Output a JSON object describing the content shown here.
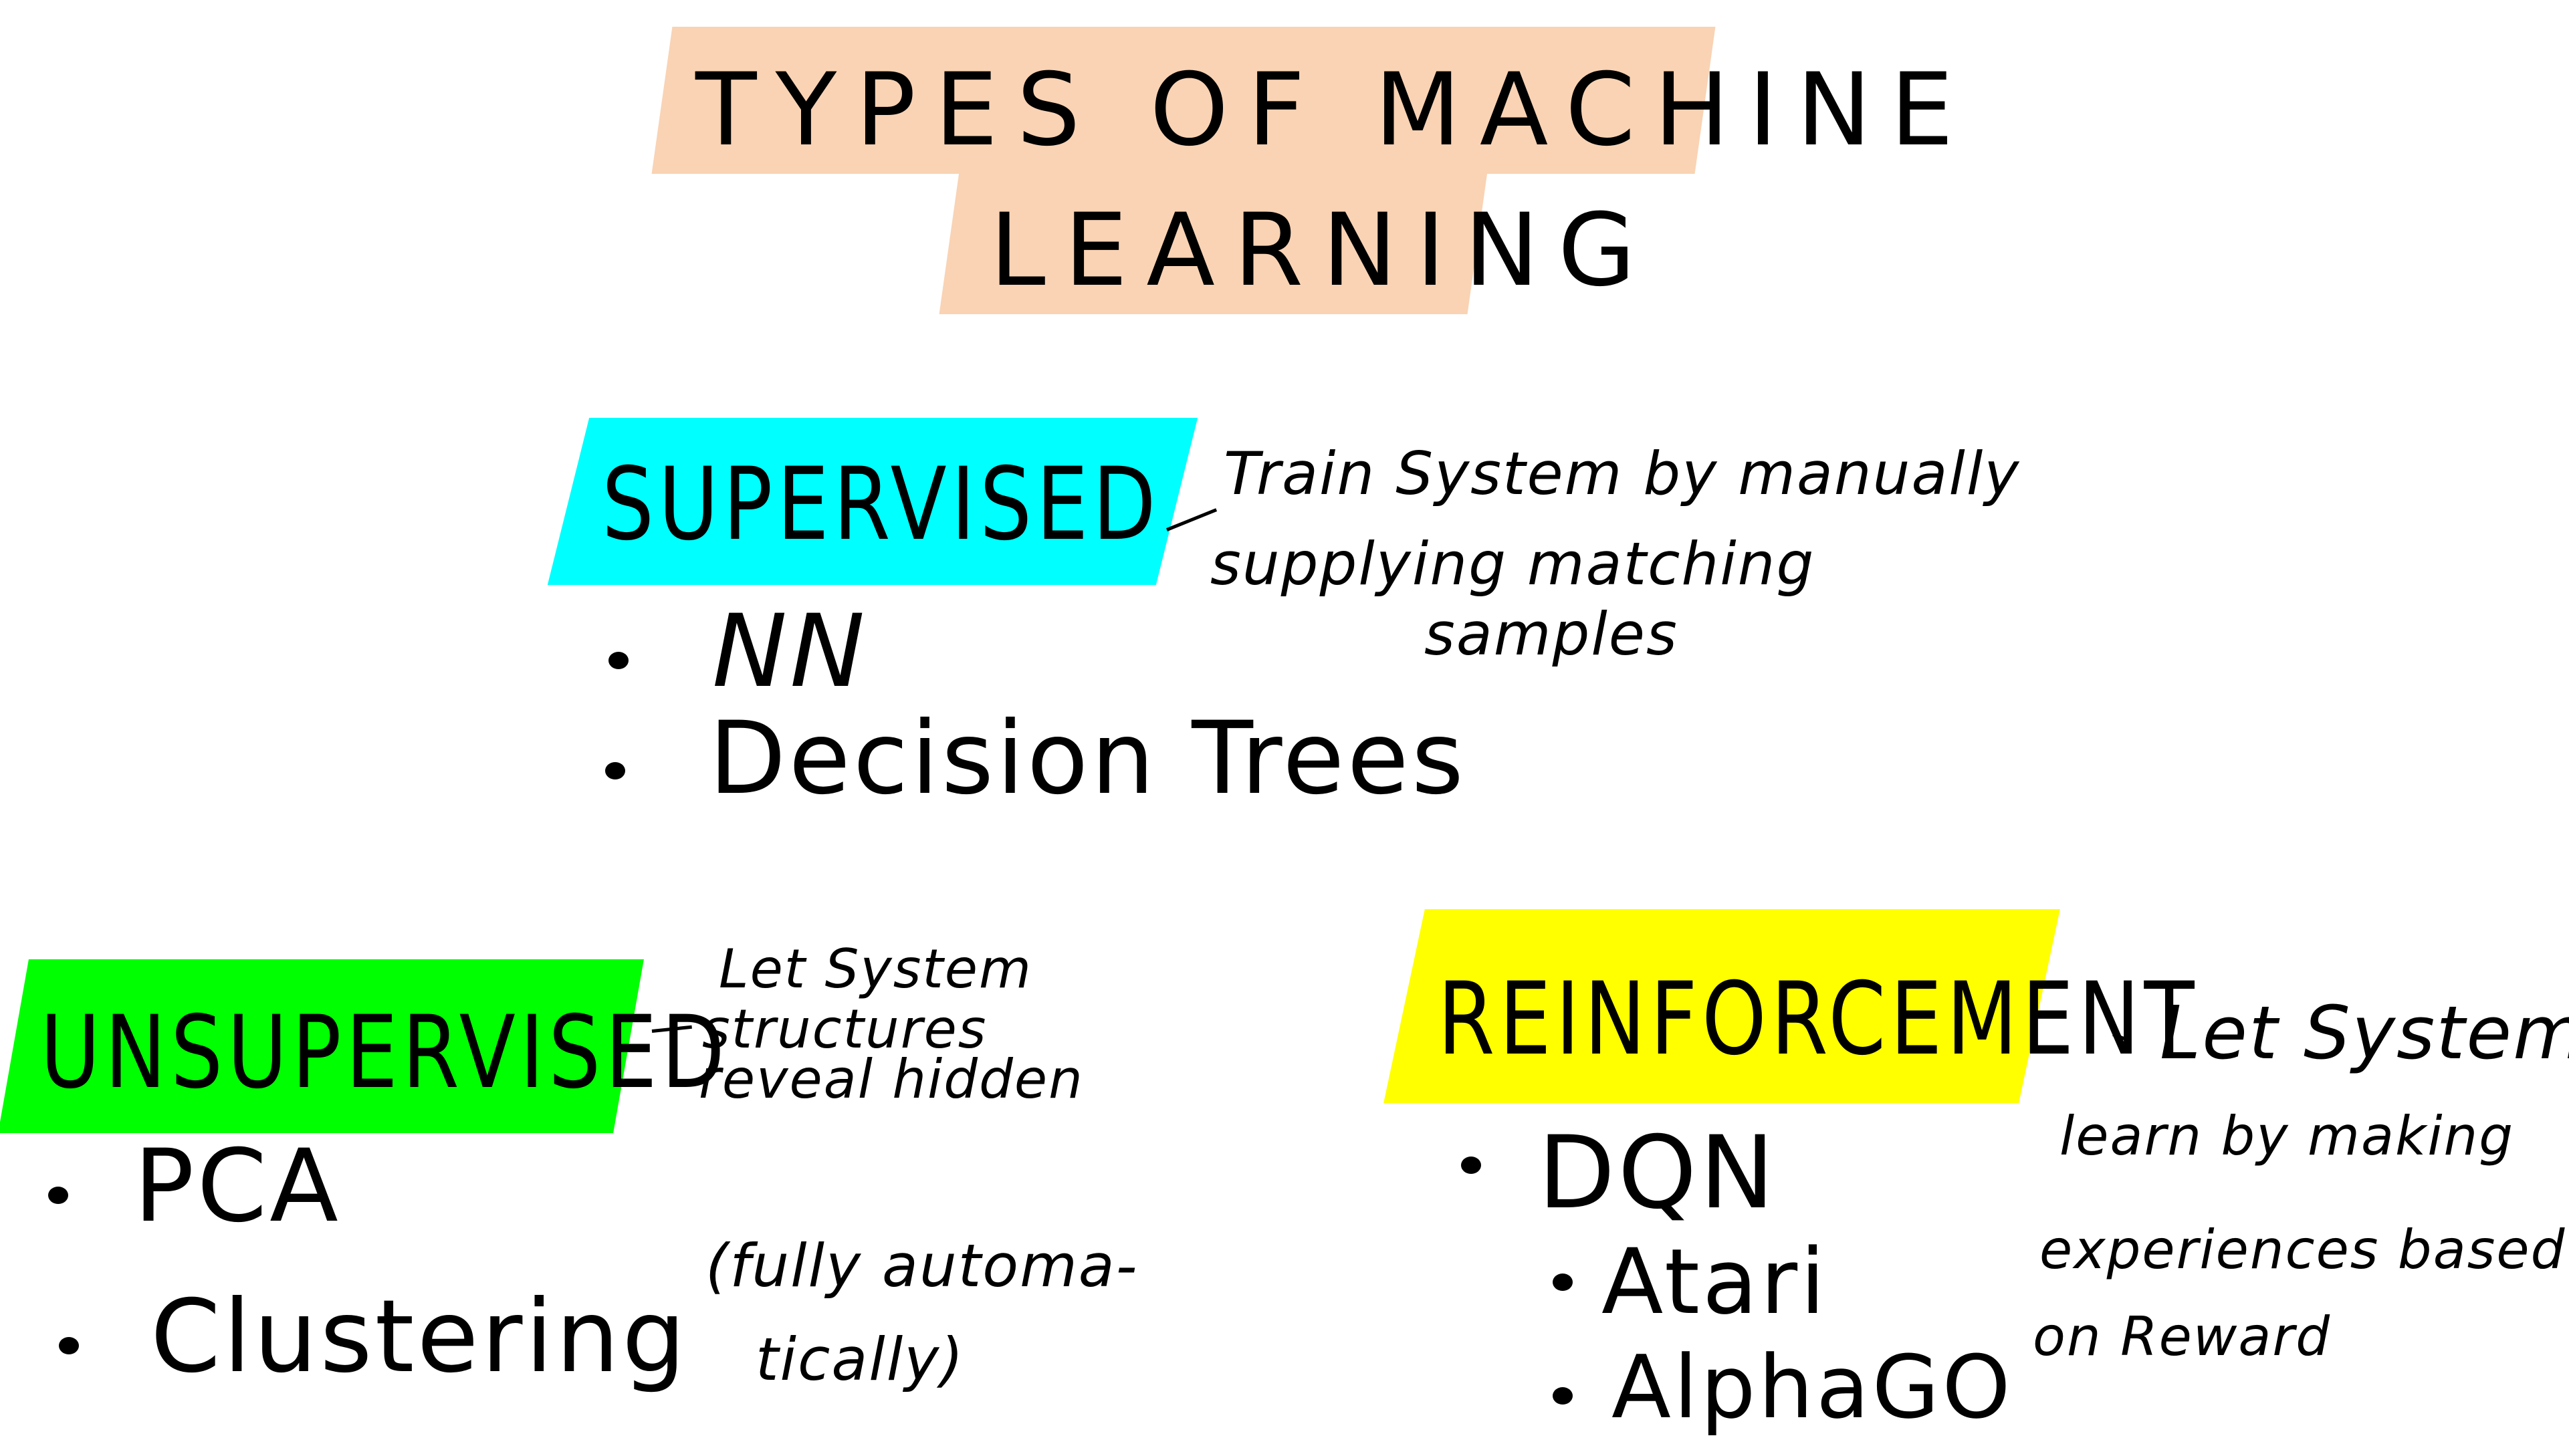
{
  "title": {
    "line1": "TYPES OF MACHINE",
    "line2": "LEARNING"
  },
  "supervised": {
    "heading": "SUPERVISED",
    "note_line1": "Train System by manually",
    "note_line2": "supplying matching",
    "note_line3": "samples",
    "items": [
      "NN",
      "Decision Trees"
    ]
  },
  "unsupervised": {
    "heading": "UNSUPERVISED",
    "note_line1": "Let System",
    "note_line2": "reveal hidden",
    "note_line3": "structures",
    "items": [
      "PCA",
      "Clustering"
    ],
    "aside_line1": "(fully automa-",
    "aside_line2": "tically)"
  },
  "reinforcement": {
    "heading": "REINFORCEMENT",
    "note_line1": "Let System",
    "note_line2": "learn by making",
    "note_line3": "experiences based",
    "note_line4": "on Reward",
    "items": [
      "DQN"
    ],
    "subitems": [
      "Atari",
      "AlphaGO"
    ]
  },
  "colors": {
    "title_highlight": "#f9d3b4",
    "supervised_highlight": "#00ffff",
    "unsupervised_highlight": "#00ff00",
    "reinforcement_highlight": "#ffff00"
  }
}
